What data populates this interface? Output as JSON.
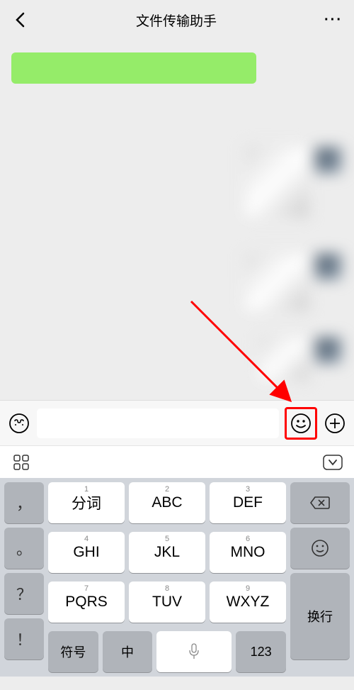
{
  "header": {
    "title": "文件传输助手"
  },
  "input": {
    "placeholder": ""
  },
  "keyboard": {
    "punctuation": [
      "，",
      "。",
      "？",
      "！"
    ],
    "keys": [
      {
        "num": "1",
        "label": "分词"
      },
      {
        "num": "2",
        "label": "ABC"
      },
      {
        "num": "3",
        "label": "DEF"
      },
      {
        "num": "4",
        "label": "GHI"
      },
      {
        "num": "5",
        "label": "JKL"
      },
      {
        "num": "6",
        "label": "MNO"
      },
      {
        "num": "7",
        "label": "PQRS"
      },
      {
        "num": "8",
        "label": "TUV"
      },
      {
        "num": "9",
        "label": "WXYZ"
      }
    ],
    "enter": "换行",
    "symbol": "符号",
    "lang": "中",
    "numeric": "123"
  }
}
